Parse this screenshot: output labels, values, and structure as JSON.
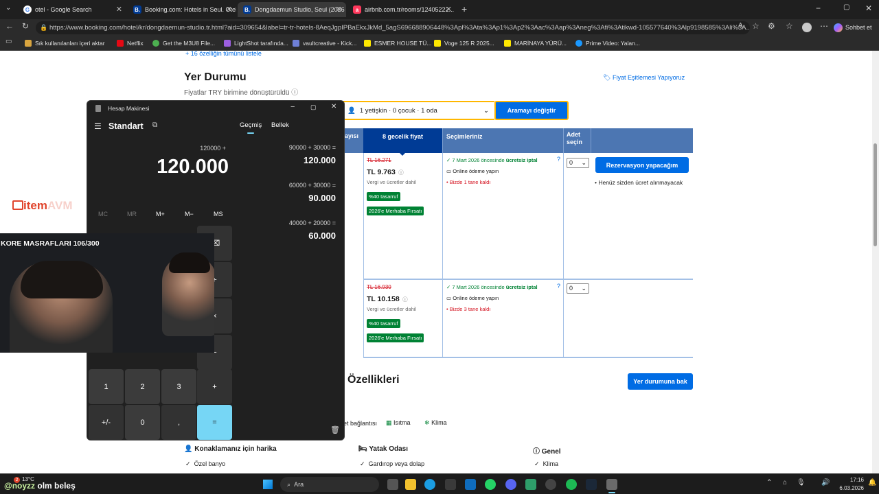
{
  "browser": {
    "tabs": [
      {
        "label": "otel - Google Search",
        "icon": "google-icon"
      },
      {
        "label": "Booking.com: Hotels in Seul. Otelin",
        "icon": "booking-icon"
      },
      {
        "label": "Dongdaemun Studio, Seul (2026 g",
        "icon": "booking-icon"
      },
      {
        "label": "airbnb.com.tr/rooms/12405222...",
        "icon": "airbnb-icon"
      }
    ],
    "url": "https://www.booking.com/hotel/kr/dongdaemun-studio.tr.html?aid=309654&label=tr-tr-hotels-8AeqJgpIPBaEkxJkMd_5agS696688906448%3Apl%3Ata%3Ap1%3Ap2%3Aac%3Aap%3Aneg%3Afi%3Atikwd-105577640%3Alp9198585%3Ali%3A...",
    "copilot_label": "Sohbet et",
    "bookmarks": [
      "Sık kullanılanları içeri aktar",
      "Netflix",
      "Get the M3U8 File...",
      "LightShot tarafında...",
      "vaultcreative - Kick...",
      "ESMER HOUSE TÜ...",
      "Voge 125 R 2025...",
      "MARİNAYA YÜRÜ...",
      "Prime Video: Yalan..."
    ]
  },
  "page": {
    "features_link": "16 özelliğin tümünü listele",
    "section_title": "Yer Durumu",
    "currency_note": "Fiyatlar TRY birimine dönüştürüldü",
    "price_match": "Fiyat Eşitlemesi Yapıyoruz",
    "guests": "1 yetişkin · 0 çocuk · 1 oda",
    "change_search": "Aramayı değiştir",
    "table_headers": {
      "capacity": "ayısı",
      "price": "8 gecelik fiyat",
      "choices": "Seçimleriniz",
      "qty": "Adet seçin"
    },
    "rows": [
      {
        "old_price": "TL 16.271",
        "price": "TL 9.763",
        "tax": "Vergi ve ücretler dahil",
        "discount": "%40 tasarruf",
        "deal": "2026'e Merhaba Fırsatı",
        "cancel_prefix": "7 Mart 2026 öncesinde ",
        "cancel_bold": "ücretsiz iptal",
        "payment": "Online ödeme yapın",
        "left": "Bizde 1 tane kaldı",
        "qty": "0"
      },
      {
        "old_price": "TL 16.930",
        "price": "TL 10.158",
        "tax": "Vergi ve ücretler dahil",
        "discount": "%40 tasarruf",
        "deal": "2026'e Merhaba Fırsatı",
        "cancel_prefix": "7 Mart 2026 öncesinde ",
        "cancel_bold": "ücretsiz iptal",
        "payment": "Online ödeme yapın",
        "left": "Bizde 3 tane kaldı",
        "qty": "0"
      }
    ],
    "reserve_button": "Rezervasyon yapacağım",
    "no_charge": "Henüz sizden ücret alınmayacak",
    "features_title": "Özellikleri",
    "view_availability": "Yer durumuna bak",
    "amenities": [
      "et bağlantısı",
      "Isıtma",
      "Klima"
    ],
    "groups": [
      {
        "title": "Konaklamanız için harika",
        "item": "Özel banyo"
      },
      {
        "title": "Yatak Odası",
        "item": "Gardırop veya dolap"
      },
      {
        "title": "Genel",
        "item": "Klima"
      }
    ]
  },
  "calculator": {
    "window_title": "Hesap Makinesi",
    "mode": "Standart",
    "tab_history": "Geçmiş",
    "tab_memory": "Bellek",
    "expression": "120000 +",
    "display": "120.000",
    "memory_keys": [
      "MC",
      "MR",
      "M+",
      "M−",
      "MS"
    ],
    "history": [
      {
        "expr": "90000   +   30000   =",
        "result": "120.000"
      },
      {
        "expr": "60000   +   30000   =",
        "result": "90.000"
      },
      {
        "expr": "40000   +   20000   =",
        "result": "60.000"
      }
    ],
    "keys": {
      "k1": "1",
      "k2": "2",
      "k3": "3",
      "plus": "+",
      "neg": "+/-",
      "k0": "0",
      "comma": ",",
      "eq": "=",
      "r1": "⌫",
      "r2": "÷",
      "r3": "×",
      "r4": "−"
    }
  },
  "overlay": {
    "logo_text": "item",
    "logo_faded": "AVM",
    "counter": "KORE MASRAFLARI 106/300",
    "streamer": "@noyzz",
    "streamer_tail": "olm beleş"
  },
  "taskbar": {
    "weather_temp": "13°C",
    "search": "Ara",
    "time": "17:16",
    "date": "6.03.2026",
    "notif_count": "2"
  }
}
